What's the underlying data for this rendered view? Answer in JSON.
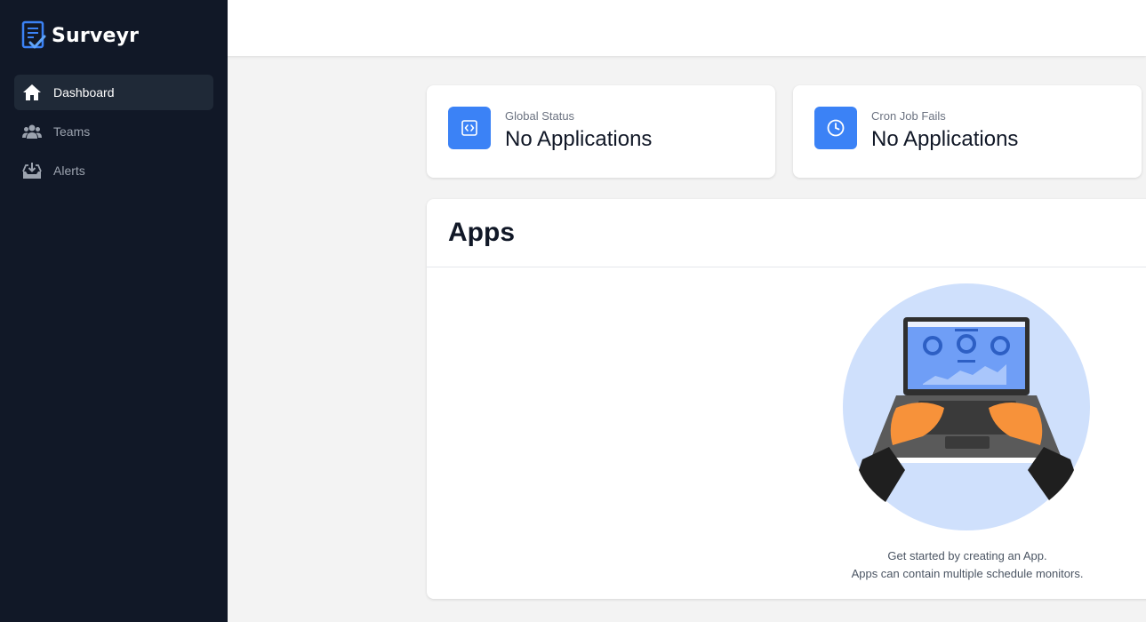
{
  "app": {
    "name": "Surveyr"
  },
  "sidebar": {
    "items": [
      {
        "label": "Dashboard",
        "icon": "home-icon",
        "active": true
      },
      {
        "label": "Teams",
        "icon": "users-icon",
        "active": false
      },
      {
        "label": "Alerts",
        "icon": "inbox-icon",
        "active": false
      }
    ]
  },
  "stats": [
    {
      "label": "Global Status",
      "value": "No Applications",
      "icon": "code-icon"
    },
    {
      "label": "Cron Job Fails",
      "value": "No Applications",
      "icon": "clock-icon"
    }
  ],
  "apps": {
    "title": "Apps",
    "empty_line1": "Get started by creating an App.",
    "empty_line2": "Apps can contain multiple schedule monitors."
  },
  "colors": {
    "sidebar": "#111827",
    "accent": "#3b82f6",
    "illustration_bg": "#cfe0fc"
  }
}
